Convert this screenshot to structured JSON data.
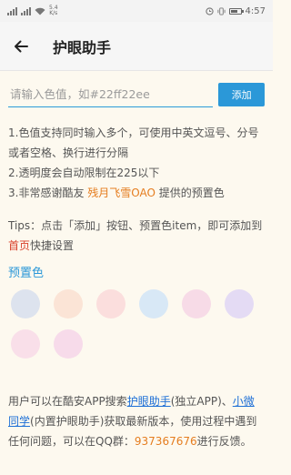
{
  "status_bar": {
    "net_top": "5.4",
    "net_bottom": "K/s",
    "battery_icon": "battery-icon",
    "time": "4:57"
  },
  "app_bar": {
    "back_icon": "arrow-left-icon",
    "title": "护眼助手"
  },
  "color_input": {
    "placeholder": "请输入色值，如#22ff22ee",
    "value": ""
  },
  "add_button_label": "添加",
  "notes": {
    "line1": "1.色值支持同时输入多个，可使用中英文逗号、分号或者空格、换行进行分隔",
    "line2": "2.透明度会自动限制在225以下",
    "line3_prefix": "3.非常感谢酷友 ",
    "line3_name": "残月飞雪OAO",
    "line3_suffix": " 提供的预置色"
  },
  "tips": {
    "prefix": "Tips：点击「添加」按钮、预置色item，即可添加到",
    "highlight": "首页",
    "suffix": "快捷设置"
  },
  "preset": {
    "title": "预置色",
    "colors": [
      "#dde3ee",
      "#fbe4d6",
      "#fbdedd",
      "#d8e8f6",
      "#f7dbe7",
      "#e4dbf4",
      "#f9dfe9",
      "#f7dbea"
    ]
  },
  "footer": {
    "part1": "用户可以在酷安APP搜索",
    "link1": "护眼助手",
    "part2": "(独立APP)、",
    "link2": "小微同学",
    "part3": "(内置护眼助手)获取最新版本，使用过程中遇到任何问题，可以在QQ群：",
    "qq": "937367676",
    "part4": "进行反馈。"
  }
}
